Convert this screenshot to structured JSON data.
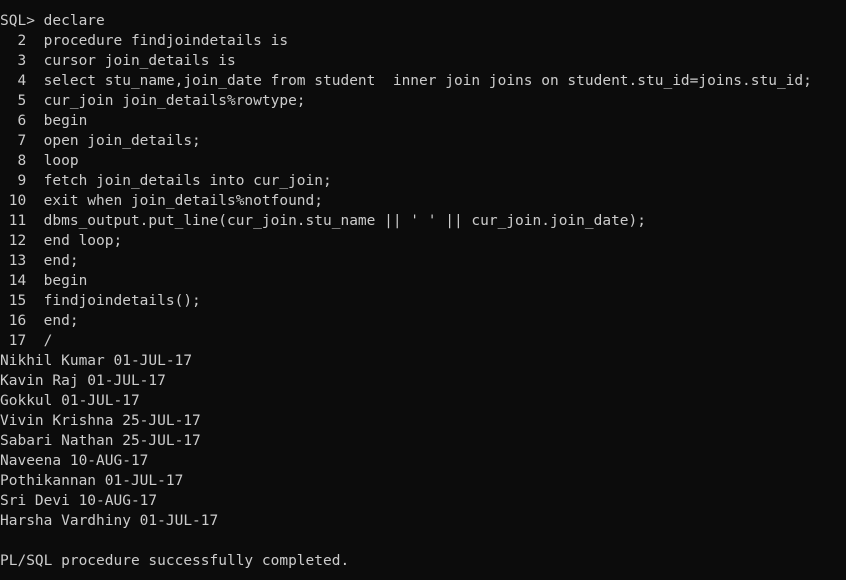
{
  "console": {
    "lines": [
      "SQL> declare",
      "  2  procedure findjoindetails is",
      "  3  cursor join_details is",
      "  4  select stu_name,join_date from student  inner join joins on student.stu_id=joins.stu_id;",
      "  5  cur_join join_details%rowtype;",
      "  6  begin",
      "  7  open join_details;",
      "  8  loop",
      "  9  fetch join_details into cur_join;",
      " 10  exit when join_details%notfound;",
      " 11  dbms_output.put_line(cur_join.stu_name || ' ' || cur_join.join_date);",
      " 12  end loop;",
      " 13  end;",
      " 14  begin",
      " 15  findjoindetails();",
      " 16  end;",
      " 17  /",
      "Nikhil Kumar 01-JUL-17",
      "Kavin Raj 01-JUL-17",
      "Gokkul 01-JUL-17",
      "Vivin Krishna 25-JUL-17",
      "Sabari Nathan 25-JUL-17",
      "Naveena 10-AUG-17",
      "Pothikannan 01-JUL-17",
      "Sri Devi 10-AUG-17",
      "Harsha Vardhiny 01-JUL-17",
      "",
      "PL/SQL procedure successfully completed."
    ]
  }
}
